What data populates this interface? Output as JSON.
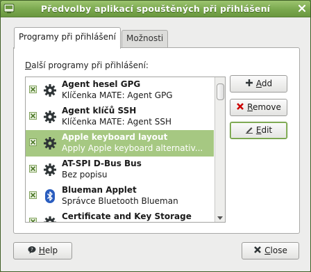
{
  "window": {
    "title": "Předvolby aplikací spouštěných při přihlášení"
  },
  "tabs": [
    {
      "label": "Programy při přihlášení",
      "active": true
    },
    {
      "label": "Možnosti",
      "active": false
    }
  ],
  "list": {
    "label_prefix": "",
    "label_mnemonic": "D",
    "label_rest": "alší programy při přihlášení:",
    "items": [
      {
        "name": "Agent hesel GPG",
        "description": "Klíčenka MATE: Agent GPG",
        "icon": "gear-icon",
        "enabled": true,
        "selected": false
      },
      {
        "name": "Agent klíčů SSH",
        "description": "Klíčenka MATE: Agent SSH",
        "icon": "gear-icon",
        "enabled": true,
        "selected": false
      },
      {
        "name": "Apple keyboard layout",
        "description": "Apply Apple keyboard alternativ...",
        "icon": "gear-icon",
        "enabled": true,
        "selected": true
      },
      {
        "name": "AT-SPI D-Bus Bus",
        "description": "Bez popisu",
        "icon": "gear-icon",
        "enabled": true,
        "selected": false
      },
      {
        "name": "Blueman Applet",
        "description": "Správce Bluetooth Blueman",
        "icon": "bluetooth-icon",
        "enabled": true,
        "selected": false
      },
      {
        "name": "Certificate and Key Storage",
        "description": "",
        "icon": "gear-icon",
        "enabled": true,
        "selected": false
      }
    ]
  },
  "buttons": {
    "add": {
      "mnemonic": "A",
      "rest": "dd"
    },
    "remove": {
      "mnemonic": "R",
      "rest": "emove"
    },
    "edit": {
      "mnemonic": "E",
      "rest": "dit"
    },
    "help": {
      "mnemonic": "H",
      "rest": "elp"
    },
    "close": {
      "mnemonic": "C",
      "rest": "lose"
    }
  },
  "colors": {
    "titlebar": "#7aa84e",
    "selection": "#a6c882"
  }
}
